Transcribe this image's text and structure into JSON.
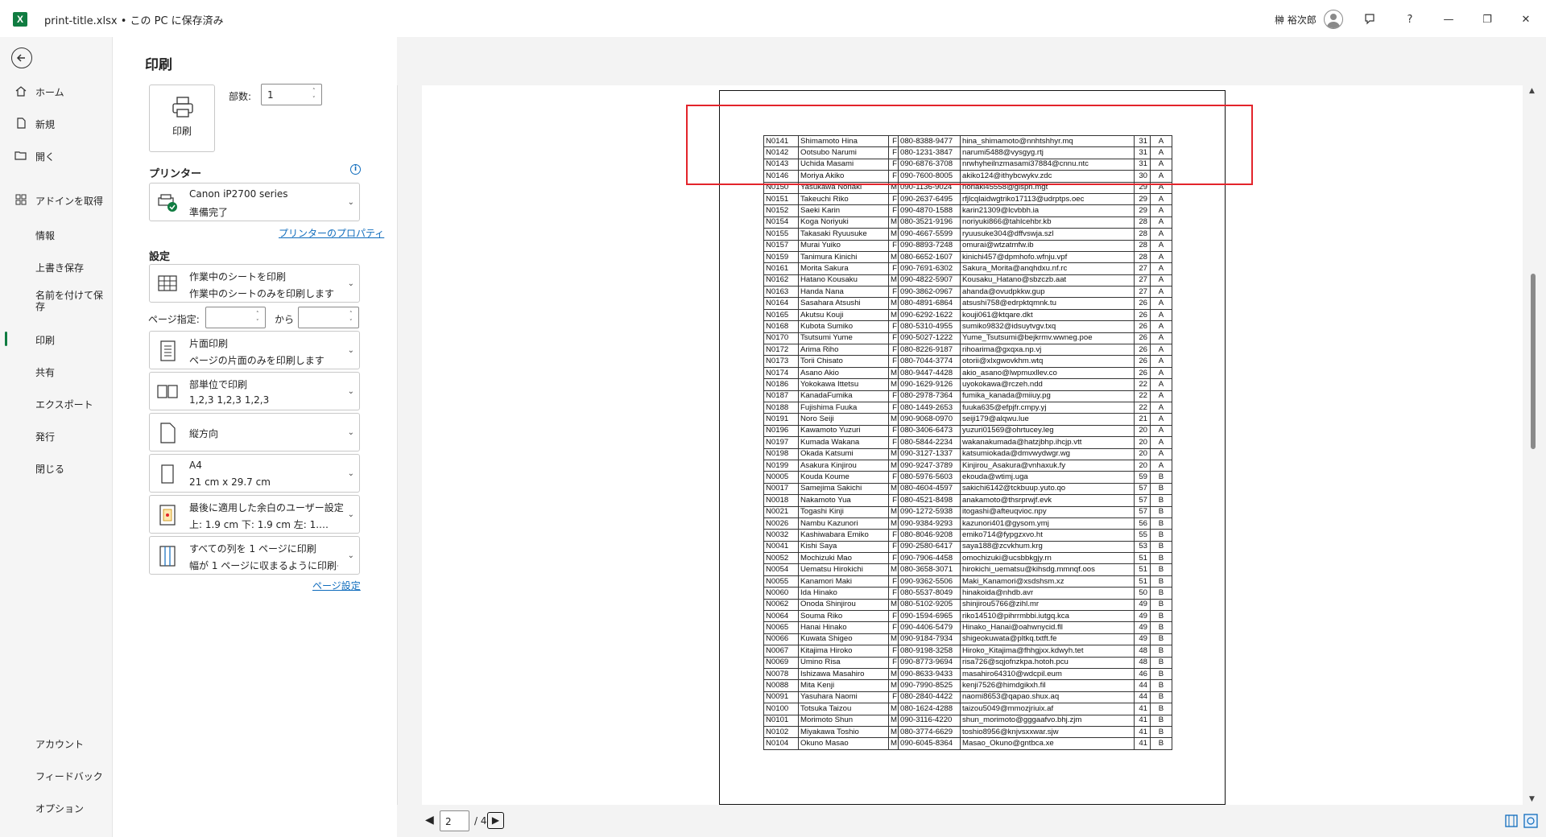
{
  "window": {
    "file_title": "print-title.xlsx • この PC に保存済み",
    "user_name": "榊 裕次郎",
    "help_label": "?",
    "minimize_label": "—",
    "maximize_label": "❐",
    "close_label": "✕"
  },
  "nav": {
    "items": [
      {
        "label": "ホーム",
        "icon": "home-icon"
      },
      {
        "label": "新規",
        "icon": "new-document-icon"
      },
      {
        "label": "開く",
        "icon": "folder-open-icon"
      },
      {
        "label": "アドインを取得",
        "icon": "addins-grid-icon"
      },
      {
        "label": "情報"
      },
      {
        "label": "上書き保存"
      },
      {
        "label": "名前を付けて保存"
      },
      {
        "label": "印刷",
        "selected": true
      },
      {
        "label": "共有"
      },
      {
        "label": "エクスポート"
      },
      {
        "label": "発行"
      },
      {
        "label": "閉じる"
      }
    ],
    "bottom": [
      {
        "label": "アカウント"
      },
      {
        "label": "フィードバック"
      },
      {
        "label": "オプション"
      }
    ]
  },
  "print": {
    "heading": "印刷",
    "print_button": "印刷",
    "copies_label": "部数:",
    "copies_value": "1",
    "printer_heading": "プリンター",
    "printer_name": "Canon iP2700 series",
    "printer_status": "準備完了",
    "printer_properties": "プリンターのプロパティ",
    "settings_heading": "設定",
    "what_title": "作業中のシートを印刷",
    "what_desc": "作業中のシートのみを印刷します",
    "pages_label": "ページ指定:",
    "pages_from": "",
    "pages_to_label": "から",
    "pages_to": "",
    "sides_title": "片面印刷",
    "sides_desc": "ページの片面のみを印刷します",
    "collate_title": "部単位で印刷",
    "collate_desc": "1,2,3    1,2,3    1,2,3",
    "orientation": "縦方向",
    "paper_title": "A4",
    "paper_desc": "21 cm x 29.7 cm",
    "margins_title": "最後に適用した余白のユーザー設定",
    "margins_desc": "上: 1.9 cm 下: 1.9 cm 左: 1.…",
    "scaling_title": "すべての列を 1 ページに印刷",
    "scaling_desc": "幅が 1 ページに収まるように印刷イ…",
    "page_setup": "ページ設定"
  },
  "pager": {
    "current": "2",
    "of_text": "/ 4"
  },
  "table": {
    "rows": [
      [
        "N0141",
        "Shimamoto Hina",
        "F",
        "080-8388-9477",
        "hina_shimamoto@nnhtshhyr.mq",
        "31",
        "A"
      ],
      [
        "N0142",
        "Ootsubo Narumi",
        "F",
        "080-1231-3847",
        "narumi5488@vysgyg.rtj",
        "31",
        "A"
      ],
      [
        "N0143",
        "Uchida Masami",
        "F",
        "090-6876-3708",
        "nrwhyheilnzmasami37884@cnnu.ntc",
        "31",
        "A"
      ],
      [
        "N0146",
        "Moriya Akiko",
        "F",
        "090-7600-8005",
        "akiko124@ithybcwykv.zdc",
        "30",
        "A"
      ],
      [
        "N0150",
        "Yasukawa Noriaki",
        "M",
        "090-1136-9024",
        "noriaki45558@gispn.mgt",
        "29",
        "A"
      ],
      [
        "N0151",
        "Takeuchi Riko",
        "F",
        "090-2637-6495",
        "rfjlcqlaidwgtriko17113@udrptps.oec",
        "29",
        "A"
      ],
      [
        "N0152",
        "Saeki Karin",
        "F",
        "090-4870-1588",
        "karin21309@lcvbbh.ia",
        "29",
        "A"
      ],
      [
        "N0154",
        "Koga Noriyuki",
        "M",
        "080-3521-9196",
        "noriyuki866@tahlcehbr.kb",
        "28",
        "A"
      ],
      [
        "N0155",
        "Takasaki Ryuusuke",
        "M",
        "090-4667-5599",
        "ryuusuke304@dffvswja.szl",
        "28",
        "A"
      ],
      [
        "N0157",
        "Murai Yuiko",
        "F",
        "090-8893-7248",
        "omurai@wtzatmfw.ib",
        "28",
        "A"
      ],
      [
        "N0159",
        "Tanimura Kinichi",
        "M",
        "080-6652-1607",
        "kinichi457@dpmhofo.wfnju.vpf",
        "28",
        "A"
      ],
      [
        "N0161",
        "Morita Sakura",
        "F",
        "090-7691-6302",
        "Sakura_Morita@anqhdxu.nf.rc",
        "27",
        "A"
      ],
      [
        "N0162",
        "Hatano Kousaku",
        "M",
        "090-4822-5907",
        "Kousaku_Hatano@sbzczb.aat",
        "27",
        "A"
      ],
      [
        "N0163",
        "Handa Nana",
        "F",
        "090-3862-0967",
        "ahanda@ovudpkkw.gup",
        "27",
        "A"
      ],
      [
        "N0164",
        "Sasahara Atsushi",
        "M",
        "080-4891-6864",
        "atsushi758@edrpktqmnk.tu",
        "26",
        "A"
      ],
      [
        "N0165",
        "Akutsu Kouji",
        "M",
        "090-6292-1622",
        "kouji061@ktqare.dkt",
        "26",
        "A"
      ],
      [
        "N0168",
        "Kubota Sumiko",
        "F",
        "080-5310-4955",
        "sumiko9832@idsuytvgv.txq",
        "26",
        "A"
      ],
      [
        "N0170",
        "Tsutsumi Yume",
        "F",
        "090-5027-1222",
        "Yume_Tsutsumi@bejkrmv.wwneg.poe",
        "26",
        "A"
      ],
      [
        "N0172",
        "Arima Riho",
        "F",
        "080-8226-9187",
        "rihoarima@gxqxa.np.vj",
        "26",
        "A"
      ],
      [
        "N0173",
        "Torii Chisato",
        "F",
        "080-7044-3774",
        "otorii@xlxgwovkhm.wtq",
        "26",
        "A"
      ],
      [
        "N0174",
        "Asano Akio",
        "M",
        "080-9447-4428",
        "akio_asano@lwpmuxllev.co",
        "26",
        "A"
      ],
      [
        "N0186",
        "Yokokawa Ittetsu",
        "M",
        "090-1629-9126",
        "uyokokawa@rczeh.ndd",
        "22",
        "A"
      ],
      [
        "N0187",
        "KanadaFumika",
        "F",
        "080-2978-7364",
        "fumika_kanada@miiuy.pg",
        "22",
        "A"
      ],
      [
        "N0188",
        "Fujishima Fuuka",
        "F",
        "080-1449-2653",
        "fuuka635@efpjfr.cmpy.yj",
        "22",
        "A"
      ],
      [
        "N0191",
        "Noro Seiji",
        "M",
        "090-9068-0970",
        "seiji179@alqwu.lue",
        "21",
        "A"
      ],
      [
        "N0196",
        "Kawamoto Yuzuri",
        "F",
        "080-3406-6473",
        "yuzuri01569@ohrtucey.leg",
        "20",
        "A"
      ],
      [
        "N0197",
        "Kumada Wakana",
        "F",
        "080-5844-2234",
        "wakanakumada@hatzjbhp.ihcjp.vtt",
        "20",
        "A"
      ],
      [
        "N0198",
        "Okada Katsumi",
        "M",
        "090-3127-1337",
        "katsumiokada@dmvwydwgr.wg",
        "20",
        "A"
      ],
      [
        "N0199",
        "Asakura Kinjirou",
        "M",
        "090-9247-3789",
        "Kinjirou_Asakura@vnhaxuk.fy",
        "20",
        "A"
      ],
      [
        "N0005",
        "Kouda Koume",
        "F",
        "080-5976-5603",
        "ekouda@wtimj.uga",
        "59",
        "B"
      ],
      [
        "N0017",
        "Samejima Sakichi",
        "M",
        "080-4604-4597",
        "sakichi6142@tckbuup.yuto.qo",
        "57",
        "B"
      ],
      [
        "N0018",
        "Nakamoto Yua",
        "F",
        "080-4521-8498",
        "anakamoto@thsrprwjf.evk",
        "57",
        "B"
      ],
      [
        "N0021",
        "Togashi Kinji",
        "M",
        "090-1272-5938",
        "itogashi@afteuqvioc.npy",
        "57",
        "B"
      ],
      [
        "N0026",
        "Nambu Kazunori",
        "M",
        "090-9384-9293",
        "kazunori401@gysom.ymj",
        "56",
        "B"
      ],
      [
        "N0032",
        "Kashiwabara Emiko",
        "F",
        "080-8046-9208",
        "emiko714@fypgzxvo.ht",
        "55",
        "B"
      ],
      [
        "N0041",
        "Kishi Saya",
        "F",
        "090-2580-6417",
        "saya188@zcvkhum.krg",
        "53",
        "B"
      ],
      [
        "N0052",
        "Mochizuki Mao",
        "F",
        "090-7906-4458",
        "omochizuki@ucsbbkgjy.rn",
        "51",
        "B"
      ],
      [
        "N0054",
        "Uematsu Hirokichi",
        "M",
        "080-3658-3071",
        "hirokichi_uematsu@kihsdg.mmnqf.oos",
        "51",
        "B"
      ],
      [
        "N0055",
        "Kanamori Maki",
        "F",
        "090-9362-5506",
        "Maki_Kanamori@xsdshsm.xz",
        "51",
        "B"
      ],
      [
        "N0060",
        "Ida Hinako",
        "F",
        "080-5537-8049",
        "hinakoida@nhdb.avr",
        "50",
        "B"
      ],
      [
        "N0062",
        "Onoda Shinjirou",
        "M",
        "080-5102-9205",
        "shinjirou5766@zihl.mr",
        "49",
        "B"
      ],
      [
        "N0064",
        "Souma Riko",
        "F",
        "090-1594-6965",
        "riko14510@pihrrmbbi.iutgq.kca",
        "49",
        "B"
      ],
      [
        "N0065",
        "Hanai Hinako",
        "F",
        "090-4406-5479",
        "Hinako_Hanai@oahwnycid.fll",
        "49",
        "B"
      ],
      [
        "N0066",
        "Kuwata Shigeo",
        "M",
        "090-9184-7934",
        "shigeokuwata@pltkq.txtft.fe",
        "49",
        "B"
      ],
      [
        "N0067",
        "Kitajima Hiroko",
        "F",
        "080-9198-3258",
        "Hiroko_Kitajima@fhhgjxx.kdwyh.tet",
        "48",
        "B"
      ],
      [
        "N0069",
        "Umino Risa",
        "F",
        "090-8773-9694",
        "risa726@sqjofnzkpa.hotoh.pcu",
        "48",
        "B"
      ],
      [
        "N0078",
        "Ishizawa Masahiro",
        "M",
        "090-8633-9433",
        "masahiro64310@wdcpil.eum",
        "46",
        "B"
      ],
      [
        "N0088",
        "Mita Kenji",
        "M",
        "090-7990-8525",
        "kenji7526@himdgikxh.fil",
        "44",
        "B"
      ],
      [
        "N0091",
        "Yasuhara Naomi",
        "F",
        "080-2840-4422",
        "naomi8653@qapao.shux.aq",
        "44",
        "B"
      ],
      [
        "N0100",
        "Totsuka Taizou",
        "M",
        "080-1624-4288",
        "taizou5049@mmozjriuix.af",
        "41",
        "B"
      ],
      [
        "N0101",
        "Morimoto Shun",
        "M",
        "090-3116-4220",
        "shun_morimoto@gggaafvo.bhj.zjm",
        "41",
        "B"
      ],
      [
        "N0102",
        "Miyakawa Toshio",
        "M",
        "080-3774-6629",
        "toshio8956@knjvsxxwar.sjw",
        "41",
        "B"
      ],
      [
        "N0104",
        "Okuno Masao",
        "M",
        "090-6045-8364",
        "Masao_Okuno@gntbca.xe",
        "41",
        "B"
      ]
    ]
  },
  "colors": {
    "accent": "#107c41",
    "highlight": "#e3242b",
    "link": "#0f6cbd"
  }
}
